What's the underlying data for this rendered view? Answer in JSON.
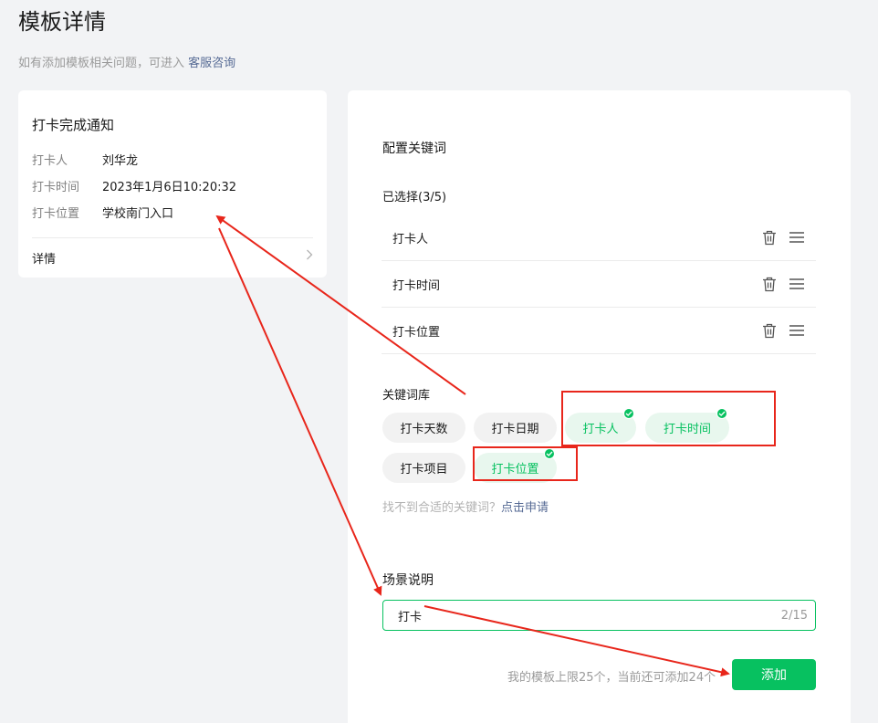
{
  "page": {
    "title": "模板详情",
    "hint_text": "如有添加模板相关问题，可进入",
    "hint_link": "客服咨询"
  },
  "preview": {
    "title": "打卡完成通知",
    "fields": [
      {
        "key": "打卡人",
        "value": "刘华龙"
      },
      {
        "key": "打卡时间",
        "value": "2023年1月6日10:20:32"
      },
      {
        "key": "打卡位置",
        "value": "学校南门入口"
      }
    ],
    "detail_label": "详情",
    "chevron": "chevron-right-icon"
  },
  "config": {
    "title": "配置关键词",
    "selected_label": "已选择(3/5)",
    "selected": [
      "打卡人",
      "打卡时间",
      "打卡位置"
    ],
    "library_label": "关键词库",
    "library": [
      {
        "label": "打卡天数",
        "selected": false
      },
      {
        "label": "打卡日期",
        "selected": false
      },
      {
        "label": "打卡人",
        "selected": true
      },
      {
        "label": "打卡时间",
        "selected": true
      },
      {
        "label": "打卡项目",
        "selected": false
      },
      {
        "label": "打卡位置",
        "selected": true
      }
    ],
    "library_hint": "找不到合适的关键词？",
    "library_hint_link": "点击申请",
    "scene_label": "场景说明",
    "scene_value": "打卡",
    "scene_count": "2/15",
    "limit_text": "我的模板上限25个，当前还可添加24个",
    "add_label": "添加"
  },
  "colors": {
    "accent": "#07c160",
    "link": "#576b95",
    "annotation": "#e8261b"
  },
  "icons": {
    "delete": "trash-icon",
    "drag": "drag-handle-icon",
    "check": "check-icon"
  }
}
